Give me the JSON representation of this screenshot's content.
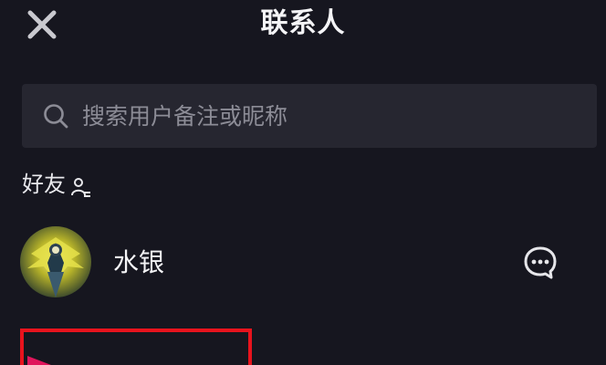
{
  "header": {
    "title": "联系人",
    "close_icon": "close-icon"
  },
  "search": {
    "placeholder": "搜索用户备注或昵称",
    "icon": "search-icon"
  },
  "section": {
    "label": "好友",
    "icon": "friends-icon"
  },
  "contacts": [
    {
      "name": "水银",
      "action_icon": "message-icon"
    }
  ],
  "colors": {
    "background": "#16161f",
    "search_bg": "#262630",
    "highlight": "#e8131d",
    "text": "#f2f2f4",
    "placeholder": "#8c8c96"
  }
}
